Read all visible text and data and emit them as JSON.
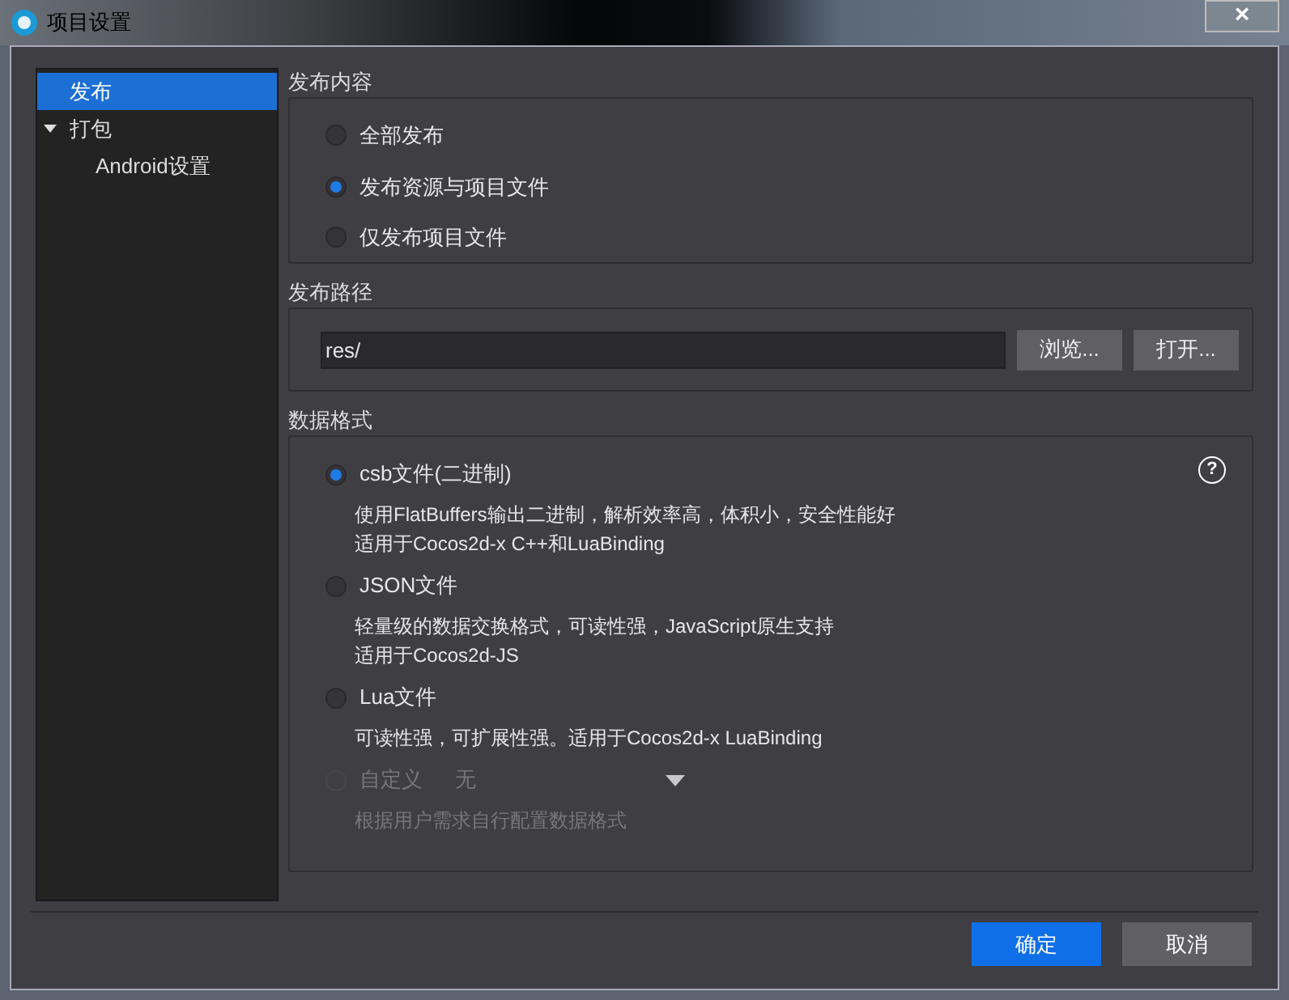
{
  "window": {
    "title": "项目设置",
    "close": "×"
  },
  "sidebar": {
    "items": [
      {
        "label": "发布",
        "selected": true
      },
      {
        "label": "打包",
        "selected": false,
        "expanded": true,
        "children": [
          {
            "label": "Android设置",
            "selected": false
          }
        ]
      }
    ]
  },
  "publish_content": {
    "title": "发布内容",
    "options": [
      {
        "label": "全部发布",
        "selected": false
      },
      {
        "label": "发布资源与项目文件",
        "selected": true
      },
      {
        "label": "仅发布项目文件",
        "selected": false
      }
    ]
  },
  "publish_path": {
    "title": "发布路径",
    "value": "res/",
    "buttons": [
      "浏览...",
      "打开..."
    ]
  },
  "data_format": {
    "title": "数据格式",
    "help": "?",
    "options": [
      {
        "label": "csb文件(二进制)",
        "selected": true,
        "disabled": false,
        "description": [
          "使用FlatBuffers输出二进制，解析效率高，体积小，安全性能好",
          "适用于Cocos2d-x C++和LuaBinding"
        ]
      },
      {
        "label": "JSON文件",
        "selected": false,
        "disabled": false,
        "description": [
          "轻量级的数据交换格式，可读性强，JavaScript原生支持",
          "适用于Cocos2d-JS"
        ]
      },
      {
        "label": "Lua文件",
        "selected": false,
        "disabled": false,
        "description": [
          "可读性强，可扩展性强。适用于Cocos2d-x LuaBinding"
        ]
      },
      {
        "label": "自定义",
        "selected": false,
        "disabled": true,
        "dropdown": "无",
        "description": [
          "根据用户需求自行配置数据格式"
        ]
      }
    ]
  },
  "buttons": [
    {
      "label": "确定",
      "kind": "primary"
    },
    {
      "label": "取消",
      "kind": "secondary"
    }
  ]
}
